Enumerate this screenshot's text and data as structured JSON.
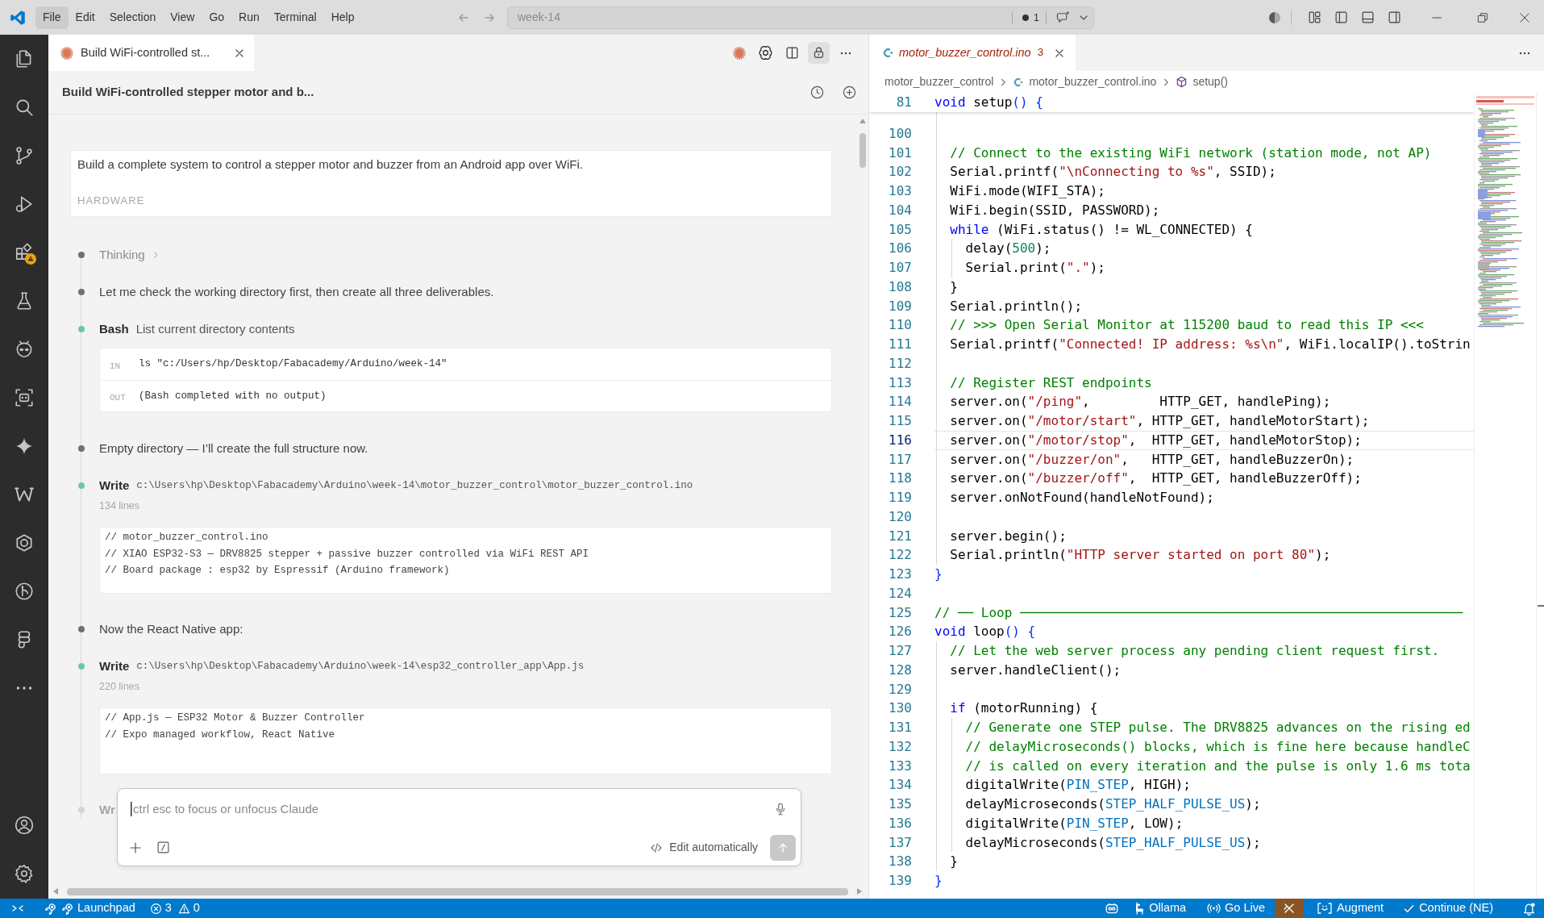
{
  "title_bar": {
    "menus": [
      {
        "label": "File",
        "selected": true
      },
      {
        "label": "Edit",
        "selected": false
      },
      {
        "label": "Selection",
        "selected": false
      },
      {
        "label": "View",
        "selected": false
      },
      {
        "label": "Go",
        "selected": false
      },
      {
        "label": "Run",
        "selected": false
      },
      {
        "label": "Terminal",
        "selected": false
      },
      {
        "label": "Help",
        "selected": false
      }
    ],
    "command_center": {
      "text": "week-14",
      "indicator_count": "1"
    }
  },
  "chat_panel": {
    "tab": {
      "title": "Build WiFi-controlled st..."
    },
    "toolbar": {
      "lock_on": true
    },
    "header": {
      "title": "Build WiFi-controlled stepper motor and b..."
    },
    "prompt": {
      "text": "Build a complete system to control a stepper motor and buzzer from an Android app over WiFi.",
      "faded_heading": "HARDWARE"
    },
    "timeline": [
      {
        "kind": "thinking",
        "label": "Thinking",
        "color": "#707070"
      },
      {
        "kind": "message",
        "text": "Let me check the working directory first, then create all three deliverables.",
        "color": "#707070"
      },
      {
        "kind": "tool",
        "tool": "Bash",
        "summary": "List current directory contents",
        "color": "#6fc7a2",
        "io": [
          {
            "label": "IN",
            "text": "ls \"c:/Users/hp/Desktop/Fabacademy/Arduino/week-14\""
          },
          {
            "label": "OUT",
            "text": "(Bash completed with no output)"
          }
        ]
      },
      {
        "kind": "message",
        "text": "Empty directory — I’ll create the full structure now.",
        "color": "#707070"
      },
      {
        "kind": "write",
        "tool": "Write",
        "path": "c:\\Users\\hp\\Desktop\\Fabacademy\\Arduino\\week-14\\motor_buzzer_control\\motor_buzzer_control.ino",
        "line_count": "134 lines",
        "color": "#6fc7a2",
        "preview": [
          "// motor_buzzer_control.ino",
          "// XIAO ESP32-S3 — DRV8825 stepper + passive buzzer controlled via WiFi REST API",
          "// Board package : esp32 by Espressif (Arduino framework)"
        ]
      },
      {
        "kind": "message",
        "text": "Now the React Native app:",
        "color": "#707070"
      },
      {
        "kind": "write",
        "tool": "Write",
        "path": "c:\\Users\\hp\\Desktop\\Fabacademy\\Arduino\\week-14\\esp32_controller_app\\App.js",
        "line_count": "220 lines",
        "color": "#6fc7a2",
        "preview": [
          "// App.js — ESP32 Motor & Buzzer Controller",
          "// Expo managed workflow, React Native"
        ]
      },
      {
        "kind": "write",
        "tool": "Wr",
        "color": "#d4d4d4"
      }
    ],
    "composer": {
      "placeholder": "ctrl esc to focus or unfocus Claude",
      "mode": "Edit automatically",
      "send_disabled": true
    }
  },
  "editor": {
    "tab": {
      "filename": "motor_buzzer_control.ino",
      "problems": "3",
      "preview": true
    },
    "breadcrumbs": [
      {
        "kind": "folder",
        "label": "motor_buzzer_control"
      },
      {
        "kind": "file",
        "label": "motor_buzzer_control.ino"
      },
      {
        "kind": "symbol",
        "label": "setup()"
      }
    ],
    "sticky_lines": [
      {
        "number": "81",
        "tokens": [
          {
            "kind": "keyword",
            "text": "void"
          },
          {
            "kind": "plain",
            "text": " setup"
          },
          {
            "kind": "bracket",
            "text": "() {"
          }
        ]
      }
    ],
    "lines": [
      {
        "number": "100",
        "current": false
      },
      {
        "number": "101",
        "current": false,
        "tokens": [
          {
            "kind": "comment",
            "text": "  // Connect to the existing WiFi network (station mode, not AP)"
          }
        ]
      },
      {
        "number": "102",
        "current": false,
        "tokens": [
          {
            "kind": "plain",
            "text": "  Serial.printf("
          },
          {
            "kind": "string",
            "text": "\"\\nConnecting to %s\""
          },
          {
            "kind": "plain",
            "text": ", SSID);"
          }
        ]
      },
      {
        "number": "103",
        "current": false,
        "tokens": [
          {
            "kind": "plain",
            "text": "  WiFi.mode(WIFI_STA);"
          }
        ]
      },
      {
        "number": "104",
        "current": false,
        "tokens": [
          {
            "kind": "plain",
            "text": "  WiFi.begin(SSID, PASSWORD);"
          }
        ]
      },
      {
        "number": "105",
        "current": false,
        "tokens": [
          {
            "kind": "keyword",
            "text": "  while"
          },
          {
            "kind": "plain",
            "text": " (WiFi.status() != WL_CONNECTED) {"
          }
        ]
      },
      {
        "number": "106",
        "current": false,
        "tokens": [
          {
            "kind": "plain",
            "text": "    delay("
          },
          {
            "kind": "number",
            "text": "500"
          },
          {
            "kind": "plain",
            "text": ");"
          }
        ]
      },
      {
        "number": "107",
        "current": false,
        "tokens": [
          {
            "kind": "plain",
            "text": "    Serial.print("
          },
          {
            "kind": "string",
            "text": "\".\""
          },
          {
            "kind": "plain",
            "text": ");"
          }
        ]
      },
      {
        "number": "108",
        "current": false,
        "tokens": [
          {
            "kind": "plain",
            "text": "  }"
          }
        ]
      },
      {
        "number": "109",
        "current": false,
        "tokens": [
          {
            "kind": "plain",
            "text": "  Serial.println();"
          }
        ]
      },
      {
        "number": "110",
        "current": false,
        "tokens": [
          {
            "kind": "comment",
            "text": "  // >>> Open Serial Monitor at 115200 baud to read this IP <<<"
          }
        ]
      },
      {
        "number": "111",
        "current": false,
        "tokens": [
          {
            "kind": "plain",
            "text": "  Serial.printf("
          },
          {
            "kind": "string",
            "text": "\"Connected! IP address: %s\\n\""
          },
          {
            "kind": "plain",
            "text": ", WiFi.localIP().toStrin"
          }
        ]
      },
      {
        "number": "112",
        "current": false
      },
      {
        "number": "113",
        "current": false,
        "tokens": [
          {
            "kind": "comment",
            "text": "  // Register REST endpoints"
          }
        ]
      },
      {
        "number": "114",
        "current": false,
        "tokens": [
          {
            "kind": "plain",
            "text": "  server.on("
          },
          {
            "kind": "string",
            "text": "\"/ping\""
          },
          {
            "kind": "plain",
            "text": ",         HTTP_GET, handlePing);"
          }
        ]
      },
      {
        "number": "115",
        "current": false,
        "tokens": [
          {
            "kind": "plain",
            "text": "  server.on("
          },
          {
            "kind": "string",
            "text": "\"/motor/start\""
          },
          {
            "kind": "plain",
            "text": ", HTTP_GET, handleMotorStart);"
          }
        ]
      },
      {
        "number": "116",
        "current": true,
        "tokens": [
          {
            "kind": "plain",
            "text": "  server.on("
          },
          {
            "kind": "string",
            "text": "\"/motor/stop\""
          },
          {
            "kind": "plain",
            "text": ",  HTTP_GET, handleMotorStop);"
          }
        ]
      },
      {
        "number": "117",
        "current": false,
        "tokens": [
          {
            "kind": "plain",
            "text": "  server.on("
          },
          {
            "kind": "string",
            "text": "\"/buzzer/on\""
          },
          {
            "kind": "plain",
            "text": ",   HTTP_GET, handleBuzzerOn);"
          }
        ]
      },
      {
        "number": "118",
        "current": false,
        "tokens": [
          {
            "kind": "plain",
            "text": "  server.on("
          },
          {
            "kind": "string",
            "text": "\"/buzzer/off\""
          },
          {
            "kind": "plain",
            "text": ",  HTTP_GET, handleBuzzerOff);"
          }
        ]
      },
      {
        "number": "119",
        "current": false,
        "tokens": [
          {
            "kind": "plain",
            "text": "  server.onNotFound(handleNotFound);"
          }
        ]
      },
      {
        "number": "120",
        "current": false
      },
      {
        "number": "121",
        "current": false,
        "tokens": [
          {
            "kind": "plain",
            "text": "  server.begin();"
          }
        ]
      },
      {
        "number": "122",
        "current": false,
        "tokens": [
          {
            "kind": "plain",
            "text": "  Serial.println("
          },
          {
            "kind": "string",
            "text": "\"HTTP server started on port 80\""
          },
          {
            "kind": "plain",
            "text": ");"
          }
        ]
      },
      {
        "number": "123",
        "current": false,
        "tokens": [
          {
            "kind": "bracket",
            "text": "}"
          }
        ]
      },
      {
        "number": "124",
        "current": false
      },
      {
        "number": "125",
        "current": false,
        "tokens": [
          {
            "kind": "comment",
            "text": "// ── Loop ─────────────────────────────────────────────────────────"
          }
        ]
      },
      {
        "number": "126",
        "current": false,
        "tokens": [
          {
            "kind": "keyword",
            "text": "void"
          },
          {
            "kind": "plain",
            "text": " loop"
          },
          {
            "kind": "bracket",
            "text": "() {"
          }
        ]
      },
      {
        "number": "127",
        "current": false,
        "tokens": [
          {
            "kind": "comment",
            "text": "  // Let the web server process any pending client request first."
          }
        ]
      },
      {
        "number": "128",
        "current": false,
        "tokens": [
          {
            "kind": "plain",
            "text": "  server.handleClient();"
          }
        ]
      },
      {
        "number": "129",
        "current": false
      },
      {
        "number": "130",
        "current": false,
        "tokens": [
          {
            "kind": "keyword",
            "text": "  if"
          },
          {
            "kind": "plain",
            "text": " (motorRunning) {"
          }
        ]
      },
      {
        "number": "131",
        "current": false,
        "tokens": [
          {
            "kind": "comment",
            "text": "    // Generate one STEP pulse. The DRV8825 advances on the rising ed"
          }
        ]
      },
      {
        "number": "132",
        "current": false,
        "tokens": [
          {
            "kind": "comment",
            "text": "    // delayMicroseconds() blocks, which is fine here because handleC"
          }
        ]
      },
      {
        "number": "133",
        "current": false,
        "tokens": [
          {
            "kind": "comment",
            "text": "    // is called on every iteration and the pulse is only 1.6 ms tota"
          }
        ]
      },
      {
        "number": "134",
        "current": false,
        "tokens": [
          {
            "kind": "plain",
            "text": "    digitalWrite("
          },
          {
            "kind": "constant",
            "text": "PIN_STEP"
          },
          {
            "kind": "plain",
            "text": ", HIGH);"
          }
        ]
      },
      {
        "number": "135",
        "current": false,
        "tokens": [
          {
            "kind": "plain",
            "text": "    delayMicroseconds("
          },
          {
            "kind": "constant",
            "text": "STEP_HALF_PULSE_US"
          },
          {
            "kind": "plain",
            "text": ");"
          }
        ]
      },
      {
        "number": "136",
        "current": false,
        "tokens": [
          {
            "kind": "plain",
            "text": "    digitalWrite("
          },
          {
            "kind": "constant",
            "text": "PIN_STEP"
          },
          {
            "kind": "plain",
            "text": ", LOW);"
          }
        ]
      },
      {
        "number": "137",
        "current": false,
        "tokens": [
          {
            "kind": "plain",
            "text": "    delayMicroseconds("
          },
          {
            "kind": "constant",
            "text": "STEP_HALF_PULSE_US"
          },
          {
            "kind": "plain",
            "text": ");"
          }
        ]
      },
      {
        "number": "138",
        "current": false,
        "tokens": [
          {
            "kind": "plain",
            "text": "  }"
          }
        ]
      },
      {
        "number": "139",
        "current": false,
        "tokens": [
          {
            "kind": "bracket",
            "text": "}"
          }
        ]
      }
    ]
  },
  "status_bar": {
    "launchpad": {
      "label": "Launchpad"
    },
    "problems": {
      "errors": "3",
      "warnings": "0"
    },
    "ollama": {
      "label": "Ollama"
    },
    "go_live": {
      "label": "Go Live"
    },
    "alert_item": {
      "highlighted": true
    },
    "augment": {
      "label": "Augment"
    },
    "continue": {
      "label": "Continue (NE)"
    }
  }
}
